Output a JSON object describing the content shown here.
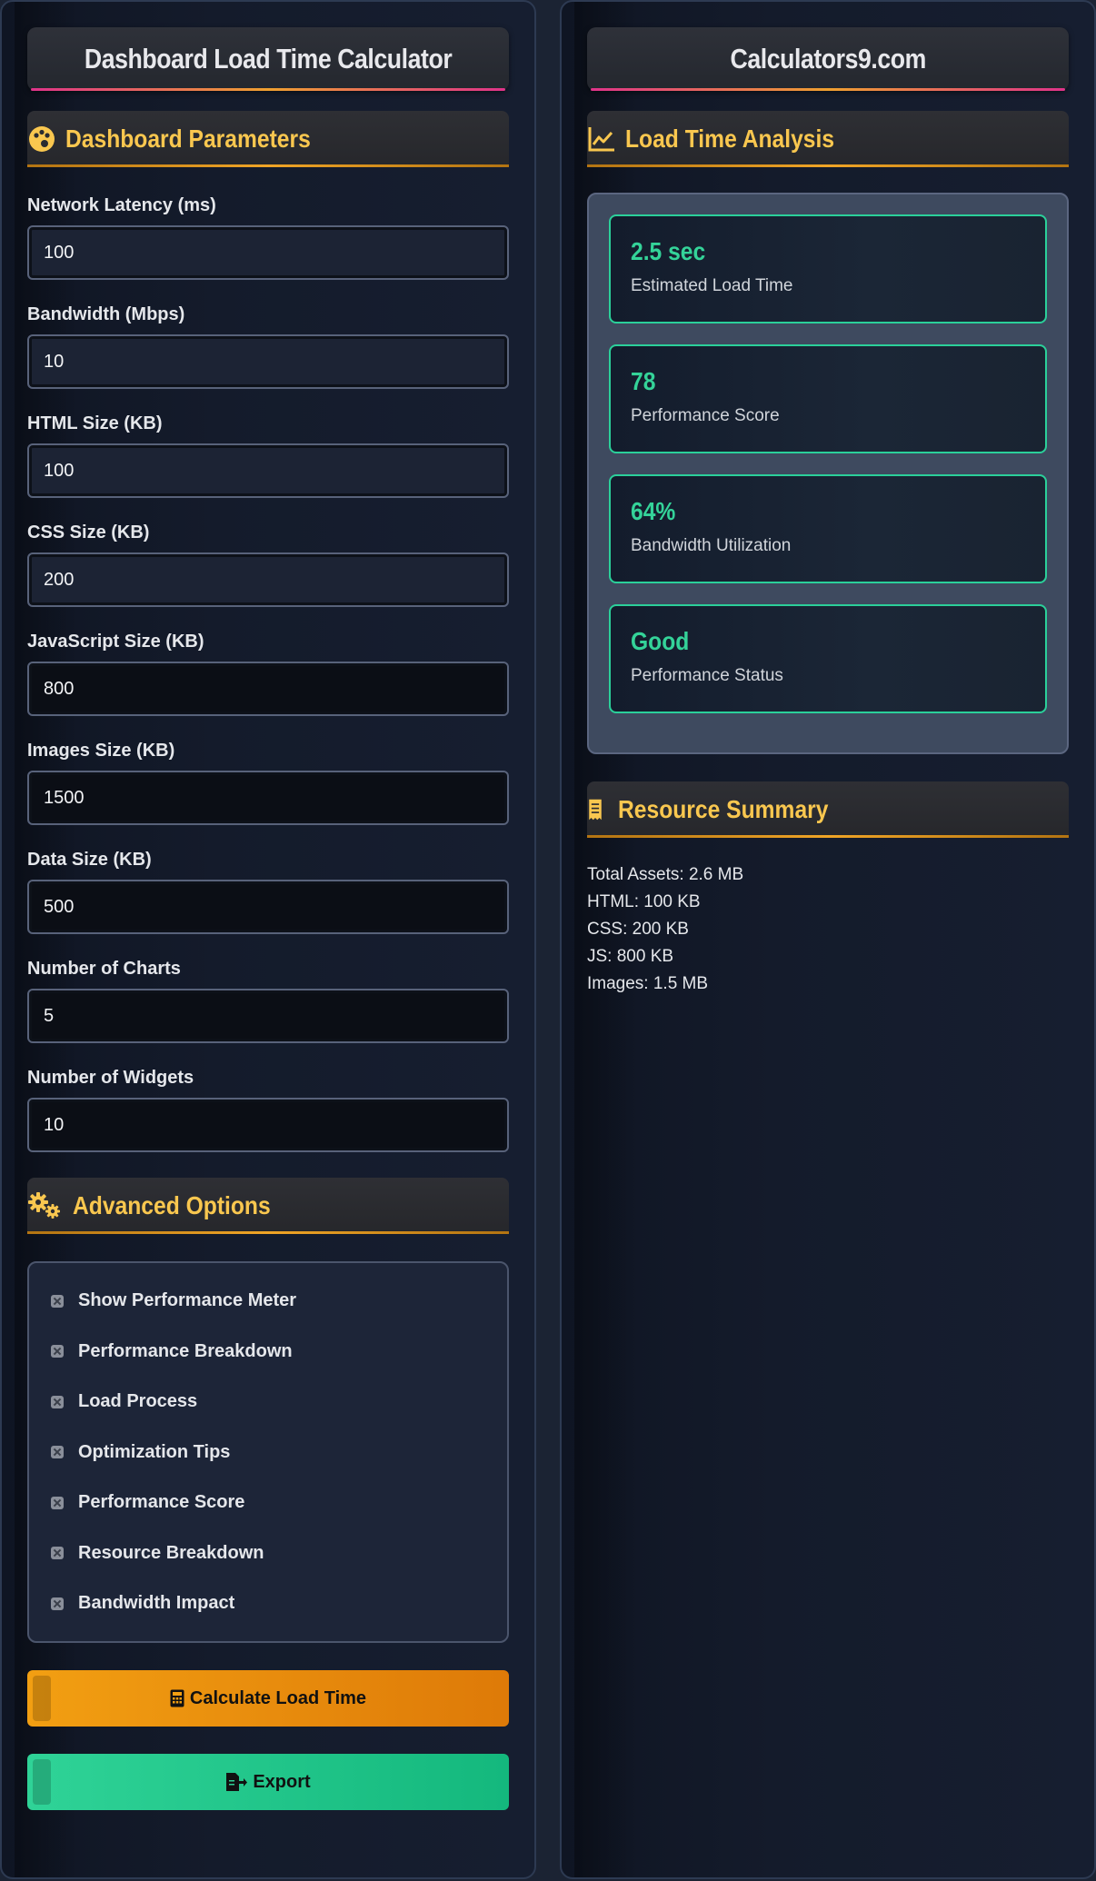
{
  "left": {
    "title": "Dashboard Load Time Calculator",
    "params_header": "Dashboard Parameters",
    "fields": [
      {
        "label": "Network Latency (ms)",
        "value": "100"
      },
      {
        "label": "Bandwidth (Mbps)",
        "value": "10"
      },
      {
        "label": "HTML Size (KB)",
        "value": "100"
      },
      {
        "label": "CSS Size (KB)",
        "value": "200"
      },
      {
        "label": "JavaScript Size (KB)",
        "value": "800"
      },
      {
        "label": "Images Size (KB)",
        "value": "1500"
      },
      {
        "label": "Data Size (KB)",
        "value": "500"
      },
      {
        "label": "Number of Charts",
        "value": "5"
      },
      {
        "label": "Number of Widgets",
        "value": "10"
      }
    ],
    "advanced_header": "Advanced Options",
    "options": [
      "Show Performance Meter",
      "Performance Breakdown",
      "Load Process",
      "Optimization Tips",
      "Performance Score",
      "Resource Breakdown",
      "Bandwidth Impact"
    ],
    "calculate_label": "Calculate Load Time",
    "export_label": "Export"
  },
  "right": {
    "title": "Calculators9.com",
    "analysis_header": "Load Time Analysis",
    "results": [
      {
        "value": "2.5 sec",
        "label": "Estimated Load Time"
      },
      {
        "value": "78",
        "label": "Performance Score"
      },
      {
        "value": "64%",
        "label": "Bandwidth Utilization"
      },
      {
        "value": "Good",
        "label": "Performance Status"
      }
    ],
    "summary_header": "Resource Summary",
    "summary_lines": [
      "Total Assets: 2.6 MB",
      "HTML: 100 KB",
      "CSS: 200 KB",
      "JS: 800 KB",
      "Images: 1.5 MB"
    ]
  },
  "icons": {
    "params": "palette-icon",
    "advanced": "gears-icon",
    "analysis": "line-chart-icon",
    "summary": "receipt-icon",
    "calculate": "calculator-icon",
    "export": "file-export-icon"
  },
  "colors": {
    "accent_yellow": "#f9c74f",
    "result_green": "#34d399",
    "calc_orange": "#f29f12",
    "export_green": "#2fd397"
  }
}
